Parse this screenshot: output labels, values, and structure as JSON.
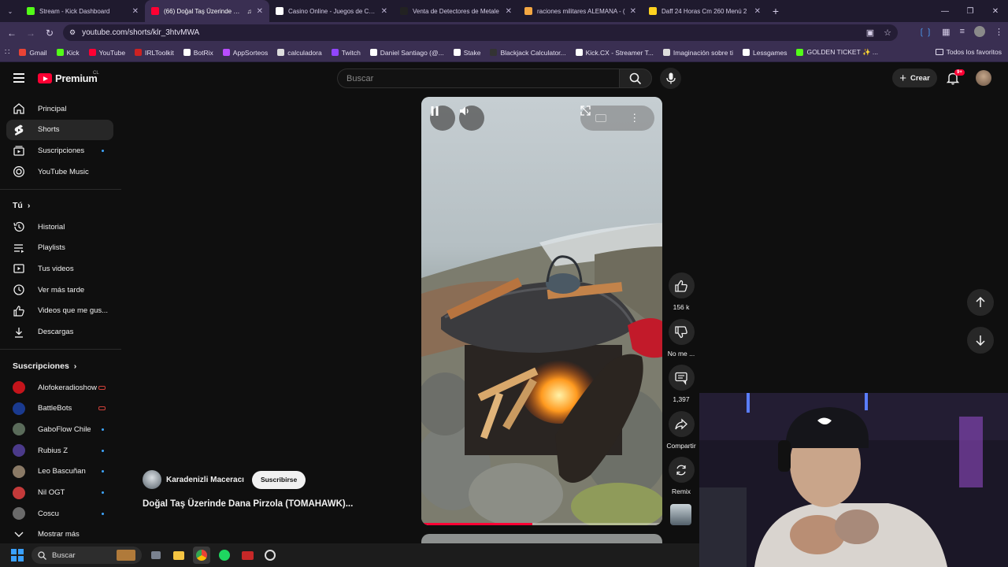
{
  "browser": {
    "tabs": [
      {
        "label": "Stream - Kick Dashboard",
        "active": false,
        "favicon": "#53fc18"
      },
      {
        "label": "(66) Doğal Taş Üzerinde Dan",
        "active": true,
        "favicon": "#ff0033"
      },
      {
        "label": "Casino Online - Juegos de Casi",
        "active": false,
        "favicon": "#ffffff"
      },
      {
        "label": "Venta de Detectores de Metale",
        "active": false,
        "favicon": "#222222"
      },
      {
        "label": "raciones militares ALEMANA - (",
        "active": false,
        "favicon": "#f4a742"
      },
      {
        "label": "Daff 24 Horas Cm 260 Menú 2",
        "active": false,
        "favicon": "#ffd21f"
      }
    ],
    "url": "youtube.com/shorts/klr_3htvMWA",
    "bookmarks": [
      {
        "label": "Gmail",
        "color": "#ea4335"
      },
      {
        "label": "Kick",
        "color": "#53fc18"
      },
      {
        "label": "YouTube",
        "color": "#ff0033"
      },
      {
        "label": "IRLToolkit",
        "color": "#cc2222"
      },
      {
        "label": "BotRix",
        "color": "#ffffff"
      },
      {
        "label": "AppSorteos",
        "color": "#b84dff"
      },
      {
        "label": "calculadora",
        "color": "#dddddd"
      },
      {
        "label": "Twitch",
        "color": "#9146ff"
      },
      {
        "label": "Daniel Santiago (@...",
        "color": "#ffffff"
      },
      {
        "label": "Stake",
        "color": "#ffffff"
      },
      {
        "label": "Blackjack Calculator...",
        "color": "#333333"
      },
      {
        "label": "Kick.CX - Streamer T...",
        "color": "#ffffff"
      },
      {
        "label": "Imaginación sobre ti",
        "color": "#dddddd"
      },
      {
        "label": "Lessgames",
        "color": "#ffffff"
      },
      {
        "label": "GOLDEN TICKET ✨ ...",
        "color": "#53fc18"
      }
    ],
    "bookmarks_all": "Todos los favoritos"
  },
  "header": {
    "logo_text": "Premium",
    "country": "CL",
    "search_placeholder": "Buscar",
    "create_label": "Crear",
    "notification_badge": "9+"
  },
  "sidebar": {
    "main": [
      {
        "label": "Principal",
        "icon": "home-icon"
      },
      {
        "label": "Shorts",
        "icon": "shorts-icon",
        "active": true
      },
      {
        "label": "Suscripciones",
        "icon": "subscriptions-icon",
        "dot": true
      },
      {
        "label": "YouTube Music",
        "icon": "music-icon"
      }
    ],
    "you_title": "Tú",
    "you": [
      {
        "label": "Historial",
        "icon": "history-icon"
      },
      {
        "label": "Playlists",
        "icon": "playlists-icon"
      },
      {
        "label": "Tus videos",
        "icon": "your-videos-icon"
      },
      {
        "label": "Ver más tarde",
        "icon": "watch-later-icon"
      },
      {
        "label": "Videos que me gus...",
        "icon": "liked-icon"
      },
      {
        "label": "Descargas",
        "icon": "downloads-icon"
      }
    ],
    "subs_title": "Suscripciones",
    "subs": [
      {
        "label": "Alofokeradioshow",
        "marker": "live",
        "color": "#c4141b"
      },
      {
        "label": "BattleBots",
        "marker": "live",
        "color": "#1a3a8f"
      },
      {
        "label": "GaboFlow Chile",
        "marker": "dot",
        "color": "#5a6b5a"
      },
      {
        "label": "Rubius Z",
        "marker": "dot",
        "color": "#4b3a8a"
      },
      {
        "label": "Leo Bascuñan",
        "marker": "dot",
        "color": "#8a7a66"
      },
      {
        "label": "Nil OGT",
        "marker": "dot",
        "color": "#c43a3a"
      },
      {
        "label": "Coscu",
        "marker": "dot",
        "color": "#6a6a6a"
      }
    ],
    "show_more": "Mostrar más"
  },
  "short": {
    "channel": "Karadenizli Maceracı",
    "subscribe_label": "Suscribirse",
    "title": "Doğal Taş Üzerinde Dana Pirzola (TOMAHAWK)...",
    "progress": 0.46,
    "actions": [
      {
        "label": "156 k",
        "icon": "like-icon"
      },
      {
        "label": "No me ...",
        "icon": "dislike-icon"
      },
      {
        "label": "1,397",
        "icon": "comments-icon"
      },
      {
        "label": "Compartir",
        "icon": "share-icon"
      },
      {
        "label": "Remix",
        "icon": "remix-icon"
      }
    ]
  },
  "taskbar": {
    "search_label": "Buscar"
  }
}
